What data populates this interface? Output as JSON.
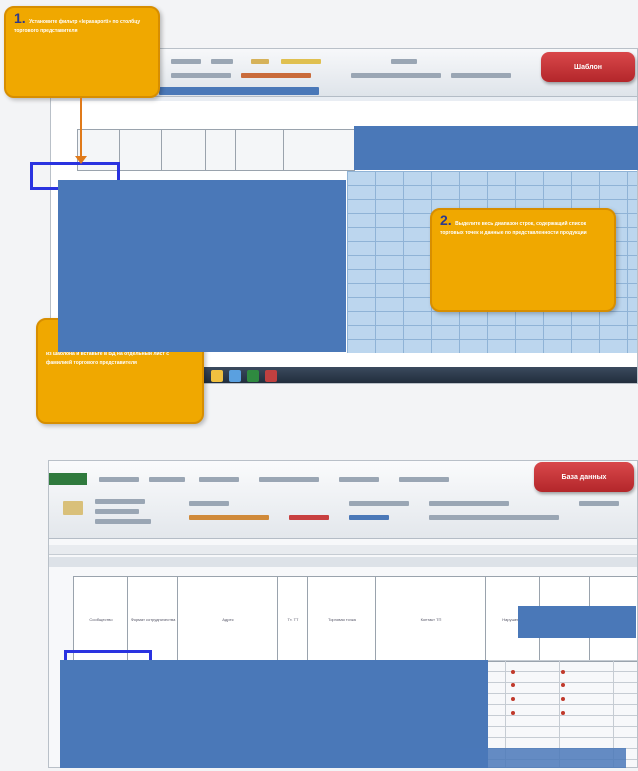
{
  "top": {
    "step1": {
      "num": "1.",
      "text": "Установите фильтр «lepasaporti» по столбцу торгового представителя"
    },
    "button": "Шаблон",
    "step2": {
      "num": "2.",
      "text": "Выделите весь диапазон строк, содержащий список торговых точек и данные по представленности продукции"
    },
    "step3_text": "из шаблона и вставьте в ВД на отдельный лист с фамилией торгового представителя"
  },
  "bottom": {
    "button": "База данных",
    "headers": [
      "Сообщество",
      "Формат сотрудничества",
      "Адрес",
      "Тт. ТТ",
      "Торговая точка",
      "Контакт ТП",
      "Нарушение"
    ]
  },
  "colors": {
    "callout": "#f0a800",
    "redButton": "#c0353a",
    "maskBlue": "#4a78b8",
    "selection": "#2a33e0"
  }
}
